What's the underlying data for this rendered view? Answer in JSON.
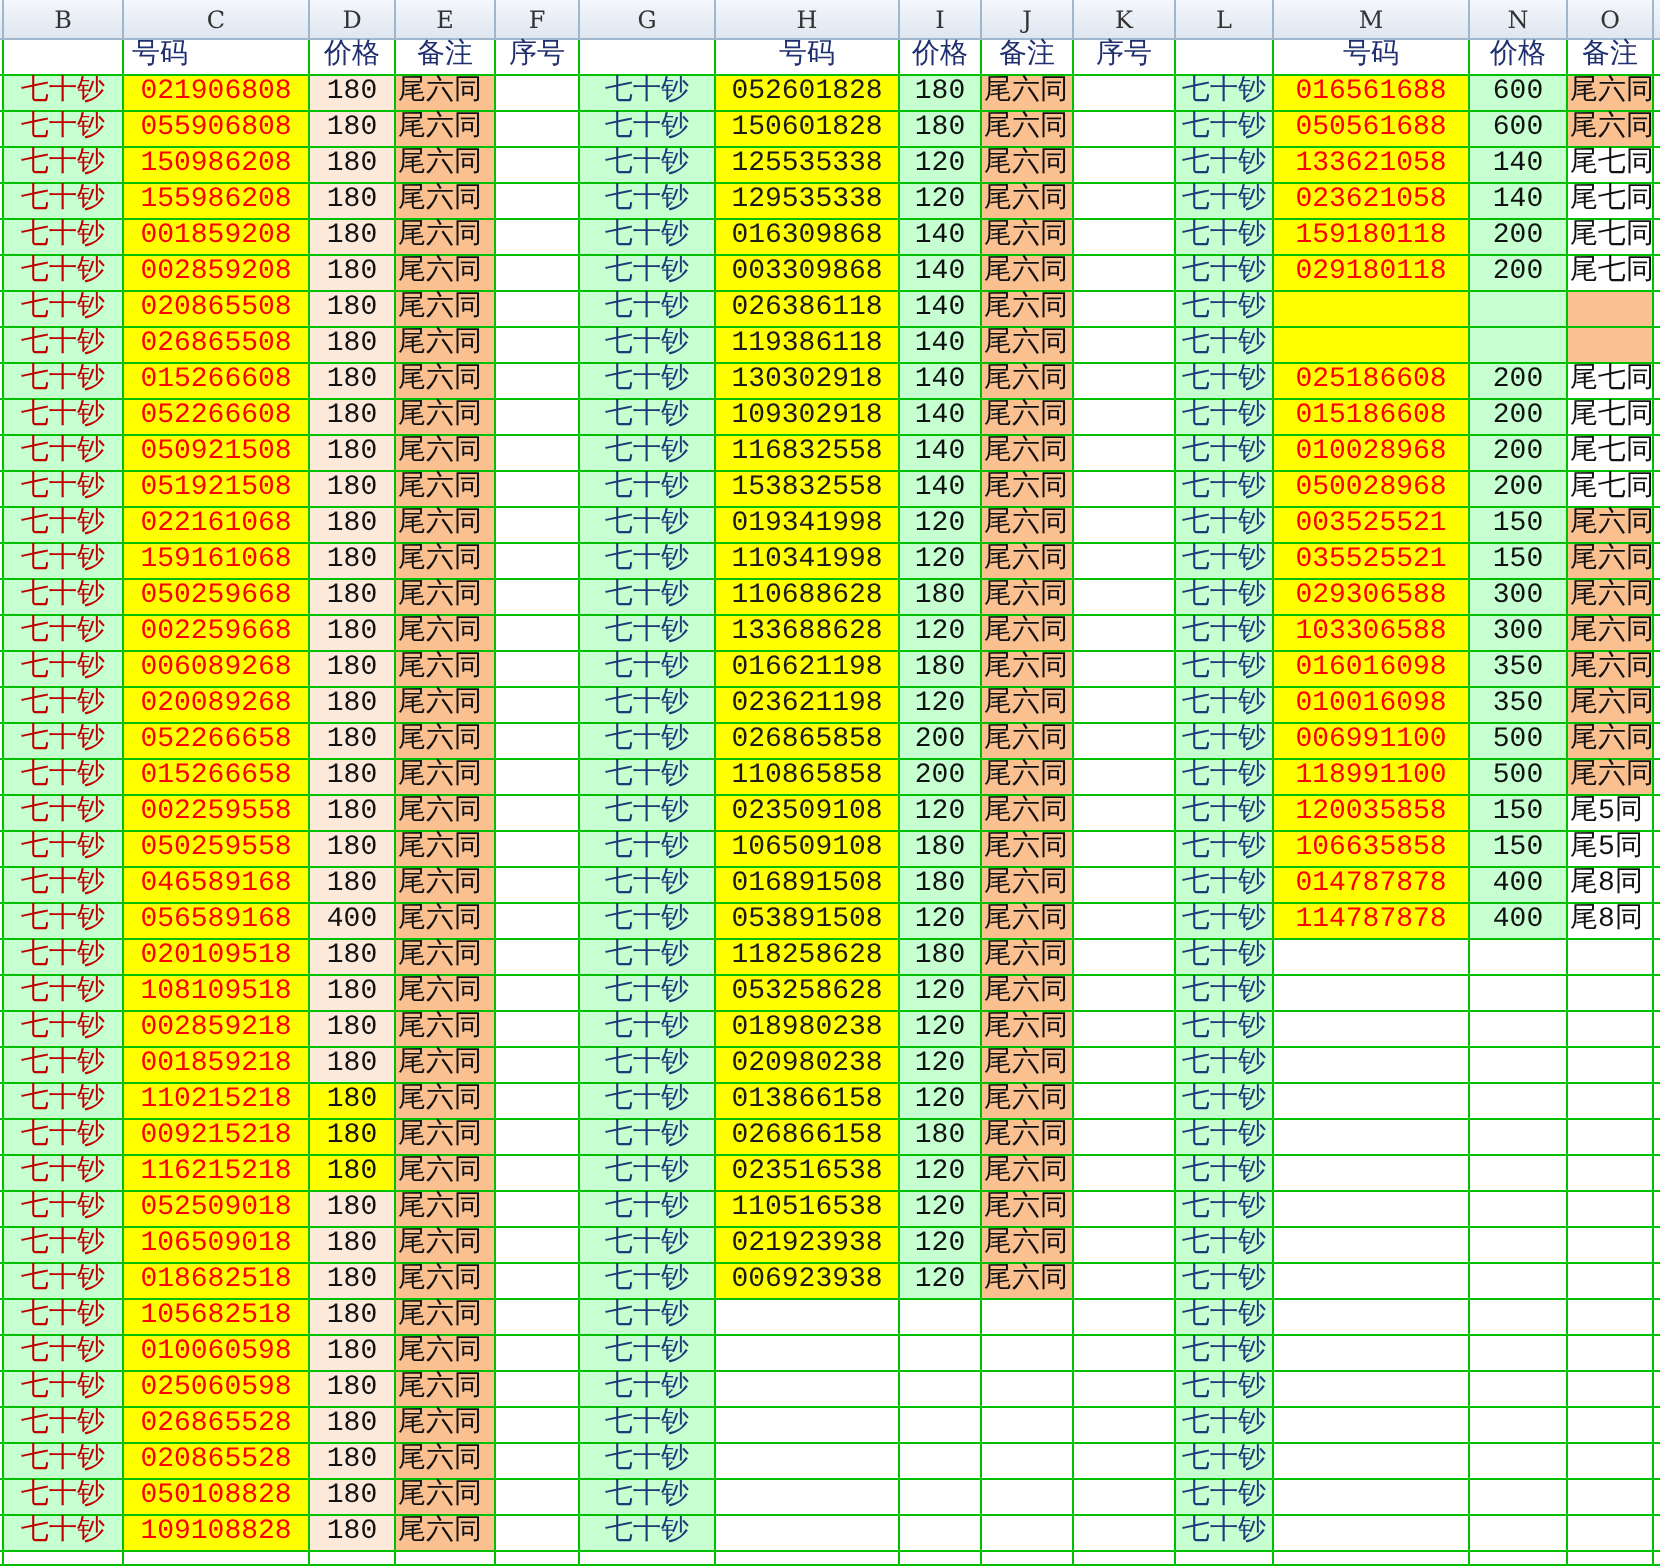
{
  "column_letters": [
    "B",
    "C",
    "D",
    "E",
    "F",
    "G",
    "H",
    "I",
    "J",
    "K",
    "L",
    "M",
    "N",
    "O"
  ],
  "blocks": [
    {
      "headers": [
        "号码",
        "价格",
        "备注",
        "序号"
      ],
      "kind": "red",
      "rows": [
        {
          "label": "七十钞",
          "filled": true,
          "number": "021906808",
          "price": "180",
          "price_marked": false,
          "note": "尾六同",
          "note_marked": true
        },
        {
          "label": "七十钞",
          "filled": true,
          "number": "055906808",
          "price": "180",
          "price_marked": false,
          "note": "尾六同",
          "note_marked": true
        },
        {
          "label": "七十钞",
          "filled": true,
          "number": "150986208",
          "price": "180",
          "price_marked": false,
          "note": "尾六同",
          "note_marked": true
        },
        {
          "label": "七十钞",
          "filled": true,
          "number": "155986208",
          "price": "180",
          "price_marked": false,
          "note": "尾六同",
          "note_marked": true
        },
        {
          "label": "七十钞",
          "filled": true,
          "number": "001859208",
          "price": "180",
          "price_marked": false,
          "note": "尾六同",
          "note_marked": true
        },
        {
          "label": "七十钞",
          "filled": true,
          "number": "002859208",
          "price": "180",
          "price_marked": false,
          "note": "尾六同",
          "note_marked": true
        },
        {
          "label": "七十钞",
          "filled": true,
          "number": "020865508",
          "price": "180",
          "price_marked": false,
          "note": "尾六同",
          "note_marked": true
        },
        {
          "label": "七十钞",
          "filled": true,
          "number": "026865508",
          "price": "180",
          "price_marked": false,
          "note": "尾六同",
          "note_marked": true
        },
        {
          "label": "七十钞",
          "filled": true,
          "number": "015266608",
          "price": "180",
          "price_marked": false,
          "note": "尾六同",
          "note_marked": true
        },
        {
          "label": "七十钞",
          "filled": true,
          "number": "052266608",
          "price": "180",
          "price_marked": false,
          "note": "尾六同",
          "note_marked": true
        },
        {
          "label": "七十钞",
          "filled": true,
          "number": "050921508",
          "price": "180",
          "price_marked": false,
          "note": "尾六同",
          "note_marked": true
        },
        {
          "label": "七十钞",
          "filled": true,
          "number": "051921508",
          "price": "180",
          "price_marked": false,
          "note": "尾六同",
          "note_marked": true
        },
        {
          "label": "七十钞",
          "filled": true,
          "number": "022161068",
          "price": "180",
          "price_marked": false,
          "note": "尾六同",
          "note_marked": true
        },
        {
          "label": "七十钞",
          "filled": true,
          "number": "159161068",
          "price": "180",
          "price_marked": false,
          "note": "尾六同",
          "note_marked": true
        },
        {
          "label": "七十钞",
          "filled": true,
          "number": "050259668",
          "price": "180",
          "price_marked": false,
          "note": "尾六同",
          "note_marked": true
        },
        {
          "label": "七十钞",
          "filled": true,
          "number": "002259668",
          "price": "180",
          "price_marked": false,
          "note": "尾六同",
          "note_marked": true
        },
        {
          "label": "七十钞",
          "filled": true,
          "number": "006089268",
          "price": "180",
          "price_marked": false,
          "note": "尾六同",
          "note_marked": true
        },
        {
          "label": "七十钞",
          "filled": true,
          "number": "020089268",
          "price": "180",
          "price_marked": false,
          "note": "尾六同",
          "note_marked": true
        },
        {
          "label": "七十钞",
          "filled": true,
          "number": "052266658",
          "price": "180",
          "price_marked": false,
          "note": "尾六同",
          "note_marked": true
        },
        {
          "label": "七十钞",
          "filled": true,
          "number": "015266658",
          "price": "180",
          "price_marked": false,
          "note": "尾六同",
          "note_marked": true
        },
        {
          "label": "七十钞",
          "filled": true,
          "number": "002259558",
          "price": "180",
          "price_marked": false,
          "note": "尾六同",
          "note_marked": true
        },
        {
          "label": "七十钞",
          "filled": true,
          "number": "050259558",
          "price": "180",
          "price_marked": false,
          "note": "尾六同",
          "note_marked": true
        },
        {
          "label": "七十钞",
          "filled": true,
          "number": "046589168",
          "price": "180",
          "price_marked": false,
          "note": "尾六同",
          "note_marked": true
        },
        {
          "label": "七十钞",
          "filled": true,
          "number": "056589168",
          "price": "400",
          "price_marked": false,
          "note": "尾六同",
          "note_marked": true
        },
        {
          "label": "七十钞",
          "filled": true,
          "number": "020109518",
          "price": "180",
          "price_marked": false,
          "note": "尾六同",
          "note_marked": true
        },
        {
          "label": "七十钞",
          "filled": true,
          "number": "108109518",
          "price": "180",
          "price_marked": false,
          "note": "尾六同",
          "note_marked": true
        },
        {
          "label": "七十钞",
          "filled": true,
          "number": "002859218",
          "price": "180",
          "price_marked": false,
          "note": "尾六同",
          "note_marked": true
        },
        {
          "label": "七十钞",
          "filled": true,
          "number": "001859218",
          "price": "180",
          "price_marked": false,
          "note": "尾六同",
          "note_marked": true
        },
        {
          "label": "七十钞",
          "filled": true,
          "number": "110215218",
          "price": "180",
          "price_marked": true,
          "note": "尾六同",
          "note_marked": true
        },
        {
          "label": "七十钞",
          "filled": true,
          "number": "009215218",
          "price": "180",
          "price_marked": true,
          "note": "尾六同",
          "note_marked": true
        },
        {
          "label": "七十钞",
          "filled": true,
          "number": "116215218",
          "price": "180",
          "price_marked": true,
          "note": "尾六同",
          "note_marked": true
        },
        {
          "label": "七十钞",
          "filled": true,
          "number": "052509018",
          "price": "180",
          "price_marked": false,
          "note": "尾六同",
          "note_marked": true
        },
        {
          "label": "七十钞",
          "filled": true,
          "number": "106509018",
          "price": "180",
          "price_marked": false,
          "note": "尾六同",
          "note_marked": true
        },
        {
          "label": "七十钞",
          "filled": true,
          "number": "018682518",
          "price": "180",
          "price_marked": false,
          "note": "尾六同",
          "note_marked": true
        },
        {
          "label": "七十钞",
          "filled": true,
          "number": "105682518",
          "price": "180",
          "price_marked": false,
          "note": "尾六同",
          "note_marked": true
        },
        {
          "label": "七十钞",
          "filled": true,
          "number": "010060598",
          "price": "180",
          "price_marked": false,
          "note": "尾六同",
          "note_marked": true
        },
        {
          "label": "七十钞",
          "filled": true,
          "number": "025060598",
          "price": "180",
          "price_marked": false,
          "note": "尾六同",
          "note_marked": true
        },
        {
          "label": "七十钞",
          "filled": true,
          "number": "026865528",
          "price": "180",
          "price_marked": false,
          "note": "尾六同",
          "note_marked": true
        },
        {
          "label": "七十钞",
          "filled": true,
          "number": "020865528",
          "price": "180",
          "price_marked": false,
          "note": "尾六同",
          "note_marked": true
        },
        {
          "label": "七十钞",
          "filled": true,
          "number": "050108828",
          "price": "180",
          "price_marked": false,
          "note": "尾六同",
          "note_marked": true
        },
        {
          "label": "七十钞",
          "filled": true,
          "number": "109108828",
          "price": "180",
          "price_marked": false,
          "note": "尾六同",
          "note_marked": true
        }
      ]
    },
    {
      "headers": [
        "号码",
        "价格",
        "备注",
        "序号"
      ],
      "kind": "dark",
      "rows": [
        {
          "label": "七十钞",
          "filled": true,
          "number": "052601828",
          "price": "180",
          "note": "尾六同",
          "note_marked": true
        },
        {
          "label": "七十钞",
          "filled": true,
          "number": "150601828",
          "price": "180",
          "note": "尾六同",
          "note_marked": true
        },
        {
          "label": "七十钞",
          "filled": true,
          "number": "125535338",
          "price": "120",
          "note": "尾六同",
          "note_marked": true
        },
        {
          "label": "七十钞",
          "filled": true,
          "number": "129535338",
          "price": "120",
          "note": "尾六同",
          "note_marked": true
        },
        {
          "label": "七十钞",
          "filled": true,
          "number": "016309868",
          "price": "140",
          "note": "尾六同",
          "note_marked": true
        },
        {
          "label": "七十钞",
          "filled": true,
          "number": "003309868",
          "price": "140",
          "note": "尾六同",
          "note_marked": true
        },
        {
          "label": "七十钞",
          "filled": true,
          "number": "026386118",
          "price": "140",
          "note": "尾六同",
          "note_marked": true
        },
        {
          "label": "七十钞",
          "filled": true,
          "number": "119386118",
          "price": "140",
          "note": "尾六同",
          "note_marked": true
        },
        {
          "label": "七十钞",
          "filled": true,
          "number": "130302918",
          "price": "140",
          "note": "尾六同",
          "note_marked": true
        },
        {
          "label": "七十钞",
          "filled": true,
          "number": "109302918",
          "price": "140",
          "note": "尾六同",
          "note_marked": true
        },
        {
          "label": "七十钞",
          "filled": true,
          "number": "116832558",
          "price": "140",
          "note": "尾六同",
          "note_marked": true
        },
        {
          "label": "七十钞",
          "filled": true,
          "number": "153832558",
          "price": "140",
          "note": "尾六同",
          "note_marked": true
        },
        {
          "label": "七十钞",
          "filled": true,
          "number": "019341998",
          "price": "120",
          "note": "尾六同",
          "note_marked": true
        },
        {
          "label": "七十钞",
          "filled": true,
          "number": "110341998",
          "price": "120",
          "note": "尾六同",
          "note_marked": true
        },
        {
          "label": "七十钞",
          "filled": true,
          "number": "110688628",
          "price": "180",
          "note": "尾六同",
          "note_marked": true
        },
        {
          "label": "七十钞",
          "filled": true,
          "number": "133688628",
          "price": "120",
          "note": "尾六同",
          "note_marked": true
        },
        {
          "label": "七十钞",
          "filled": true,
          "number": "016621198",
          "price": "180",
          "note": "尾六同",
          "note_marked": true
        },
        {
          "label": "七十钞",
          "filled": true,
          "number": "023621198",
          "price": "120",
          "note": "尾六同",
          "note_marked": true
        },
        {
          "label": "七十钞",
          "filled": true,
          "number": "026865858",
          "price": "200",
          "note": "尾六同",
          "note_marked": true
        },
        {
          "label": "七十钞",
          "filled": true,
          "number": "110865858",
          "price": "200",
          "note": "尾六同",
          "note_marked": true
        },
        {
          "label": "七十钞",
          "filled": true,
          "number": "023509108",
          "price": "120",
          "note": "尾六同",
          "note_marked": true
        },
        {
          "label": "七十钞",
          "filled": true,
          "number": "106509108",
          "price": "180",
          "note": "尾六同",
          "note_marked": true
        },
        {
          "label": "七十钞",
          "filled": true,
          "number": "016891508",
          "price": "180",
          "note": "尾六同",
          "note_marked": true
        },
        {
          "label": "七十钞",
          "filled": true,
          "number": "053891508",
          "price": "120",
          "note": "尾六同",
          "note_marked": true
        },
        {
          "label": "七十钞",
          "filled": true,
          "number": "118258628",
          "price": "180",
          "note": "尾六同",
          "note_marked": true
        },
        {
          "label": "七十钞",
          "filled": true,
          "number": "053258628",
          "price": "120",
          "note": "尾六同",
          "note_marked": true
        },
        {
          "label": "七十钞",
          "filled": true,
          "number": "018980238",
          "price": "120",
          "note": "尾六同",
          "note_marked": true
        },
        {
          "label": "七十钞",
          "filled": true,
          "number": "020980238",
          "price": "120",
          "note": "尾六同",
          "note_marked": true
        },
        {
          "label": "七十钞",
          "filled": true,
          "number": "013866158",
          "price": "120",
          "note": "尾六同",
          "note_marked": true
        },
        {
          "label": "七十钞",
          "filled": true,
          "number": "026866158",
          "price": "180",
          "note": "尾六同",
          "note_marked": true
        },
        {
          "label": "七十钞",
          "filled": true,
          "number": "023516538",
          "price": "120",
          "note": "尾六同",
          "note_marked": true
        },
        {
          "label": "七十钞",
          "filled": true,
          "number": "110516538",
          "price": "120",
          "note": "尾六同",
          "note_marked": true
        },
        {
          "label": "七十钞",
          "filled": true,
          "number": "021923938",
          "price": "120",
          "note": "尾六同",
          "note_marked": true
        },
        {
          "label": "七十钞",
          "filled": true,
          "number": "006923938",
          "price": "120",
          "note": "尾六同",
          "note_marked": true
        },
        {
          "label": "七十钞",
          "filled": false
        },
        {
          "label": "七十钞",
          "filled": false
        },
        {
          "label": "七十钞",
          "filled": false
        },
        {
          "label": "七十钞",
          "filled": false
        },
        {
          "label": "七十钞",
          "filled": false
        },
        {
          "label": "七十钞",
          "filled": false
        },
        {
          "label": "七十钞",
          "filled": false
        }
      ]
    },
    {
      "headers": [
        "号码",
        "价格",
        "备注"
      ],
      "kind": "mixed",
      "rows": [
        {
          "label": "七十钞",
          "filled": true,
          "number": "016561688",
          "price": "600",
          "note": "尾六同",
          "note_marked": true
        },
        {
          "label": "七十钞",
          "filled": true,
          "number": "050561688",
          "price": "600",
          "note": "尾六同",
          "note_marked": true
        },
        {
          "label": "七十钞",
          "filled": true,
          "number": "133621058",
          "price": "140",
          "note": "尾七同",
          "note_marked": false
        },
        {
          "label": "七十钞",
          "filled": true,
          "number": "023621058",
          "price": "140",
          "note": "尾七同",
          "note_marked": false
        },
        {
          "label": "七十钞",
          "filled": true,
          "number": "159180118",
          "price": "200",
          "note": "尾七同",
          "note_marked": false
        },
        {
          "label": "七十钞",
          "filled": true,
          "number": "029180118",
          "price": "200",
          "note": "尾七同",
          "note_marked": false
        },
        {
          "label": "七十钞",
          "filled": true,
          "note_marked": true
        },
        {
          "label": "七十钞",
          "filled": true,
          "note_marked": true
        },
        {
          "label": "七十钞",
          "filled": true,
          "number": "025186608",
          "price": "200",
          "note": "尾七同",
          "note_marked": false
        },
        {
          "label": "七十钞",
          "filled": true,
          "number": "015186608",
          "price": "200",
          "note": "尾七同",
          "note_marked": false
        },
        {
          "label": "七十钞",
          "filled": true,
          "number": "010028968",
          "price": "200",
          "note": "尾七同",
          "note_marked": false
        },
        {
          "label": "七十钞",
          "filled": true,
          "number": "050028968",
          "price": "200",
          "note": "尾七同",
          "note_marked": false
        },
        {
          "label": "七十钞",
          "filled": true,
          "number": "003525521",
          "price": "150",
          "note": "尾六同",
          "note_marked": true
        },
        {
          "label": "七十钞",
          "filled": true,
          "number": "035525521",
          "price": "150",
          "note": "尾六同",
          "note_marked": true
        },
        {
          "label": "七十钞",
          "filled": true,
          "number": "029306588",
          "price": "300",
          "note": "尾六同",
          "note_marked": true
        },
        {
          "label": "七十钞",
          "filled": true,
          "number": "103306588",
          "price": "300",
          "note": "尾六同",
          "note_marked": true
        },
        {
          "label": "七十钞",
          "filled": true,
          "number": "016016098",
          "price": "350",
          "note": "尾六同",
          "note_marked": true
        },
        {
          "label": "七十钞",
          "filled": true,
          "number": "010016098",
          "price": "350",
          "note": "尾六同",
          "note_marked": true
        },
        {
          "label": "七十钞",
          "filled": true,
          "number": "006991100",
          "price": "500",
          "note": "尾六同",
          "note_marked": true
        },
        {
          "label": "七十钞",
          "filled": true,
          "number": "118991100",
          "price": "500",
          "note": "尾六同",
          "note_marked": true
        },
        {
          "label": "七十钞",
          "filled": true,
          "number": "120035858",
          "price": "150",
          "note": "尾5同",
          "note_marked": false
        },
        {
          "label": "七十钞",
          "filled": true,
          "number": "106635858",
          "price": "150",
          "note": "尾5同",
          "note_marked": false
        },
        {
          "label": "七十钞",
          "filled": true,
          "number": "014787878",
          "price": "400",
          "note": "尾8同",
          "note_marked": false
        },
        {
          "label": "七十钞",
          "filled": true,
          "number": "114787878",
          "price": "400",
          "note": "尾8同",
          "note_marked": false
        },
        {
          "label": "七十钞",
          "filled": false
        },
        {
          "label": "七十钞",
          "filled": false
        },
        {
          "label": "七十钞",
          "filled": false
        },
        {
          "label": "七十钞",
          "filled": false
        },
        {
          "label": "七十钞",
          "filled": false
        },
        {
          "label": "七十钞",
          "filled": false
        },
        {
          "label": "七十钞",
          "filled": false
        },
        {
          "label": "七十钞",
          "filled": false
        },
        {
          "label": "七十钞",
          "filled": false
        },
        {
          "label": "七十钞",
          "filled": false
        },
        {
          "label": "七十钞",
          "filled": false
        },
        {
          "label": "七十钞",
          "filled": false
        },
        {
          "label": "七十钞",
          "filled": false
        },
        {
          "label": "七十钞",
          "filled": false
        },
        {
          "label": "七十钞",
          "filled": false
        },
        {
          "label": "七十钞",
          "filled": false
        },
        {
          "label": "七十钞",
          "filled": false
        }
      ]
    }
  ]
}
